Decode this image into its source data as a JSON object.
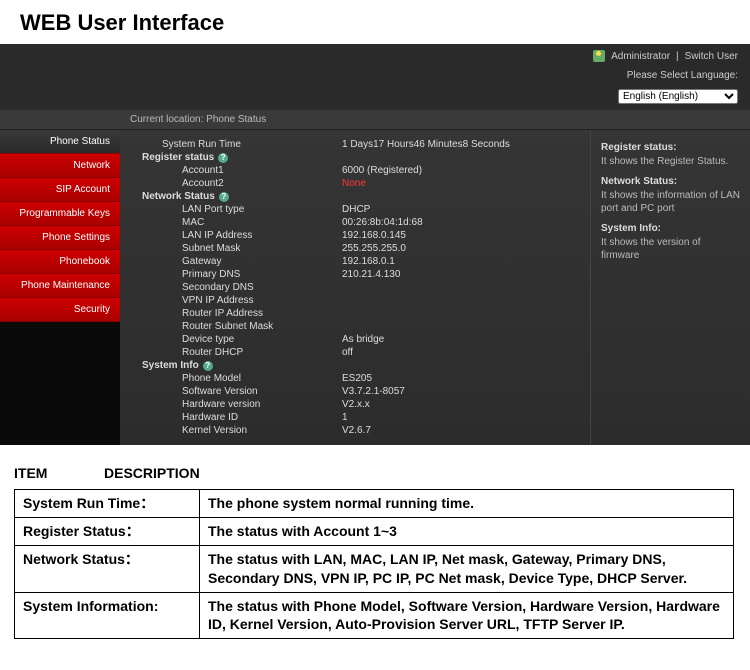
{
  "pageTitle": "WEB User Interface",
  "topbar": {
    "admin": "Administrator",
    "switch": "Switch User"
  },
  "lang": {
    "label": "Please Select Language:",
    "value": "English (English)"
  },
  "crumb": "Current location: Phone Status",
  "side": [
    "Phone Status",
    "Network",
    "SIP Account",
    "Programmable Keys",
    "Phone Settings",
    "Phonebook",
    "Phone Maintenance",
    "Security"
  ],
  "runtime": {
    "lbl": "System Run Time",
    "val": "1 Days17 Hours46 Minutes8 Seconds"
  },
  "register": {
    "title": "Register status",
    "rows": [
      {
        "lbl": "Account1",
        "val": "6000 (Registered)"
      },
      {
        "lbl": "Account2",
        "val": "None",
        "red": true
      }
    ]
  },
  "network": {
    "title": "Network Status",
    "rows": [
      {
        "lbl": "LAN Port type",
        "val": "DHCP"
      },
      {
        "lbl": "MAC",
        "val": "00:26:8b:04:1d:68"
      },
      {
        "lbl": "LAN IP Address",
        "val": "192.168.0.145"
      },
      {
        "lbl": "Subnet Mask",
        "val": "255.255.255.0"
      },
      {
        "lbl": "Gateway",
        "val": "192.168.0.1"
      },
      {
        "lbl": "Primary DNS",
        "val": "210.21.4.130"
      },
      {
        "lbl": "Secondary DNS",
        "val": ""
      },
      {
        "lbl": "VPN IP Address",
        "val": ""
      },
      {
        "lbl": "Router IP Address",
        "val": ""
      },
      {
        "lbl": "Router Subnet Mask",
        "val": ""
      },
      {
        "lbl": "Device type",
        "val": "As bridge"
      },
      {
        "lbl": "Router DHCP",
        "val": "off"
      }
    ]
  },
  "system": {
    "title": "System Info",
    "rows": [
      {
        "lbl": "Phone Model",
        "val": "ES205"
      },
      {
        "lbl": "Software Version",
        "val": "V3.7.2.1-8057"
      },
      {
        "lbl": "Hardware version",
        "val": "V2.x.x"
      },
      {
        "lbl": "Hardware ID",
        "val": "1"
      },
      {
        "lbl": "Kernel Version",
        "val": "V2.6.7"
      }
    ]
  },
  "help": {
    "h1": "Register status:",
    "p1": "It shows the Register Status.",
    "h2": "Network Status:",
    "p2": "It shows the information of LAN port and PC port",
    "h3": "System Info:",
    "p3": "It shows the version of firmware"
  },
  "descHead": {
    "a": "ITEM",
    "b": "DESCRIPTION"
  },
  "desc": [
    {
      "k": "System Run Time：",
      "v": "The phone system normal running time."
    },
    {
      "k": "Register Status：",
      "v": "The status with Account 1~3"
    },
    {
      "k": "Network Status：",
      "v": "The status with LAN, MAC, LAN IP, Net mask, Gateway, Primary DNS, Secondary DNS, VPN IP, PC IP, PC Net mask, Device Type, DHCP Server."
    },
    {
      "k": "System Information:",
      "v": "The status with Phone Model, Software Version, Hardware Version, Hardware ID, Kernel Version, Auto-Provision Server URL, TFTP Server IP."
    }
  ]
}
